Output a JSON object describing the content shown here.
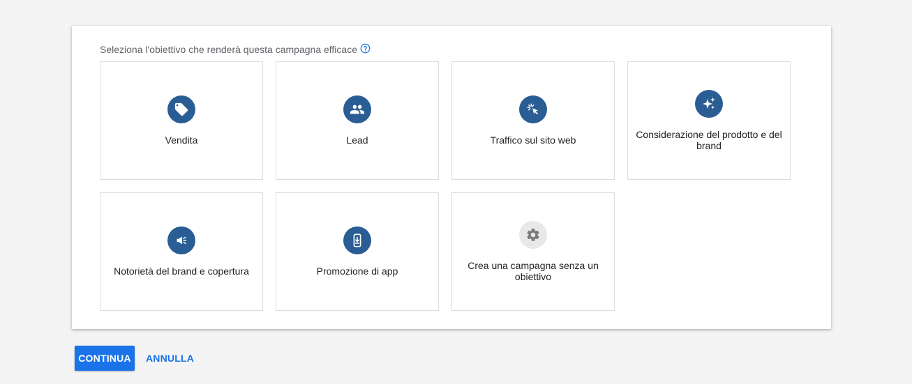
{
  "prompt": {
    "text": "Seleziona l'obiettivo che renderà questa campagna efficace",
    "help_icon": "help-circle-icon"
  },
  "colors": {
    "icon_circle": "#2a5d94",
    "icon_circle_disabled": "#e8e8e8",
    "primary": "#1a73e8"
  },
  "goals": [
    {
      "label": "Vendita",
      "icon": "tag-icon"
    },
    {
      "label": "Lead",
      "icon": "people-icon"
    },
    {
      "label": "Traffico sul sito web",
      "icon": "cursor-click-icon"
    },
    {
      "label": "Considerazione del prodotto e del brand",
      "icon": "sparkle-icon"
    },
    {
      "label": "Notorietà del brand e copertura",
      "icon": "speaker-icon"
    },
    {
      "label": "Promozione di app",
      "icon": "phone-download-icon"
    },
    {
      "label": "Crea una campagna senza un obiettivo",
      "icon": "gear-icon"
    }
  ],
  "actions": {
    "continue_label": "CONTINUA",
    "cancel_label": "ANNULLA"
  }
}
